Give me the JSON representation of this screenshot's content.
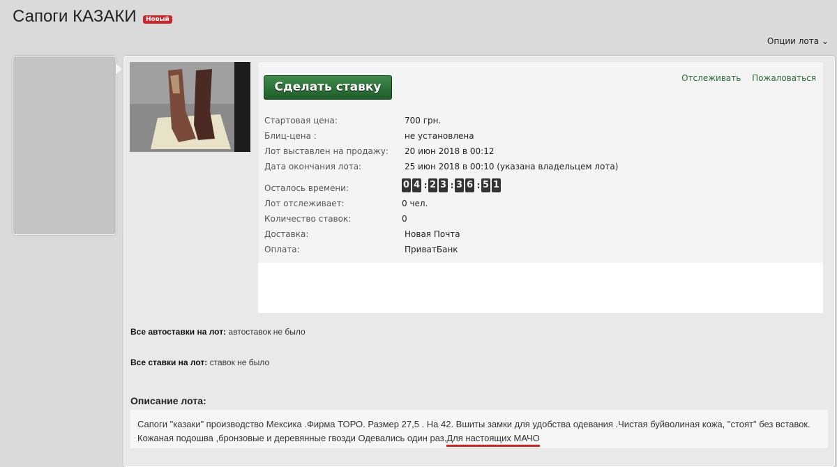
{
  "header": {
    "title": "Сапоги КАЗАКИ",
    "badge": "Новый",
    "options": "Опции лота ⌄"
  },
  "lot": {
    "bid_button": "Сделать ставку",
    "links": [
      "Отслеживать",
      "Пожаловаться"
    ],
    "fields": [
      {
        "label": "Стартовая цена:",
        "value": "700 грн."
      },
      {
        "label": "Блиц-цена :",
        "value": "не установлена"
      },
      {
        "label": "Лот выставлен на продажу:",
        "value": "20 июн 2018 в 00:12"
      },
      {
        "label": "Дата окончания лота:",
        "value": "25 июн 2018 в 00:10 (указана владельцем лота)"
      }
    ],
    "timer_label": "Осталось времени:",
    "timer": [
      "0",
      "4",
      "2",
      "3",
      "3",
      "6",
      "5",
      "1"
    ],
    "fields2": [
      {
        "label": "Лот отслеживает:",
        "value": "0 чел."
      },
      {
        "label": "Количество ставок:",
        "value": "0"
      },
      {
        "label": "Доставка:",
        "value": "Новая Почта"
      },
      {
        "label": "Оплата:",
        "value": "ПриватБанк"
      }
    ]
  },
  "autobids": {
    "label": "Все автоставки на лот:",
    "value": "автоставок не было"
  },
  "bids": {
    "label": "Все ставки на лот:",
    "value": "ставок не было"
  },
  "description": {
    "title": "Описание лота:",
    "text": "Сапоги \"казаки\" производство Мексика .Фирма ТОРО. Размер 27,5 . На 42. Вшиты замки для удобства одевания .Чистая буйволиная кожа, \"стоят\" без вставок. Кожаная подошва ,бронзовые и деревянные гвозди Одевались один раз.",
    "highlight": "Для настоящих МАЧО"
  },
  "colors": {
    "accent": "#2c6b36",
    "badge": "#c8262b",
    "underline": "#d42020"
  }
}
